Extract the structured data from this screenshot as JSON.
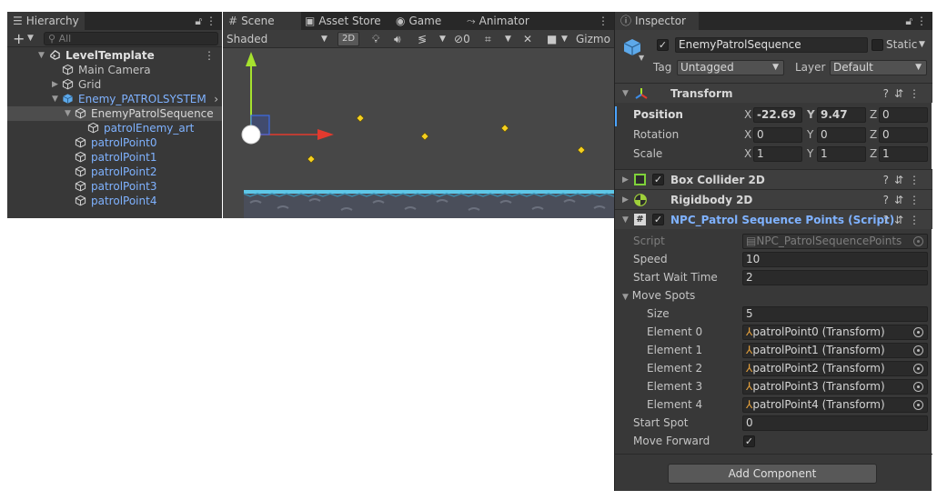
{
  "hierarchy": {
    "tab_label": "Hierarchy",
    "search_placeholder": "All",
    "rows": [
      {
        "label": "LevelTemplate",
        "depth": 0,
        "icon": "unity-scene-icon",
        "expanded": true
      },
      {
        "label": "Main Camera",
        "depth": 1,
        "icon": "cube-icon"
      },
      {
        "label": "Grid",
        "depth": 1,
        "icon": "cube-icon",
        "collapsed": true
      },
      {
        "label": "Enemy_PATROLSYSTEM",
        "depth": 1,
        "icon": "prefab-cube-icon",
        "expanded": true
      },
      {
        "label": "EnemyPatrolSequence",
        "depth": 2,
        "icon": "cube-icon",
        "expanded": true,
        "selected": true
      },
      {
        "label": "patrolEnemy_art",
        "depth": 3,
        "icon": "cube-icon"
      },
      {
        "label": "patrolPoint0",
        "depth": 2,
        "icon": "cube-icon"
      },
      {
        "label": "patrolPoint1",
        "depth": 2,
        "icon": "cube-icon"
      },
      {
        "label": "patrolPoint2",
        "depth": 2,
        "icon": "cube-icon"
      },
      {
        "label": "patrolPoint3",
        "depth": 2,
        "icon": "cube-icon"
      },
      {
        "label": "patrolPoint4",
        "depth": 2,
        "icon": "cube-icon"
      }
    ]
  },
  "scene": {
    "tabs": [
      "Scene",
      "Asset Store",
      "Game",
      "Animator"
    ],
    "shading_mode": "Shaded",
    "mode_2d_label": "2D",
    "hidden_count": "0",
    "gizmos_label": "Gizmo"
  },
  "inspector": {
    "tab_label": "Inspector",
    "object_name": "EnemyPatrolSequence",
    "static_label": "Static",
    "tag_label": "Tag",
    "tag_value": "Untagged",
    "layer_label": "Layer",
    "layer_value": "Default",
    "transform": {
      "title": "Transform",
      "position_label": "Position",
      "rotation_label": "Rotation",
      "scale_label": "Scale",
      "position": {
        "x": "-22.69",
        "y": "9.47",
        "z": "0"
      },
      "rotation": {
        "x": "0",
        "y": "0",
        "z": "0"
      },
      "scale": {
        "x": "1",
        "y": "1",
        "z": "1"
      },
      "axis_x": "X",
      "axis_y": "Y",
      "axis_z": "Z"
    },
    "box_collider_title": "Box Collider 2D",
    "rigidbody_title": "Rigidbody 2D",
    "script_component": {
      "title": "NPC_Patrol Sequence Points (Script)",
      "script_label": "Script",
      "script_value": "NPC_PatrolSequencePoints",
      "speed_label": "Speed",
      "speed_value": "10",
      "start_wait_label": "Start Wait Time",
      "start_wait_value": "2",
      "move_spots_label": "Move Spots",
      "size_label": "Size",
      "size_value": "5",
      "elements": [
        {
          "label": "Element 0",
          "value": "patrolPoint0 (Transform)"
        },
        {
          "label": "Element 1",
          "value": "patrolPoint1 (Transform)"
        },
        {
          "label": "Element 2",
          "value": "patrolPoint2 (Transform)"
        },
        {
          "label": "Element 3",
          "value": "patrolPoint3 (Transform)"
        },
        {
          "label": "Element 4",
          "value": "patrolPoint4 (Transform)"
        }
      ],
      "start_spot_label": "Start Spot",
      "start_spot_value": "0",
      "move_forward_label": "Move Forward",
      "move_forward_checked": true
    },
    "add_component_label": "Add Component"
  },
  "colors": {
    "panel_bg": "#383838",
    "tab_bg": "#282828",
    "link_blue": "#7fb2ff",
    "selected_row": "#4d4d4d"
  }
}
